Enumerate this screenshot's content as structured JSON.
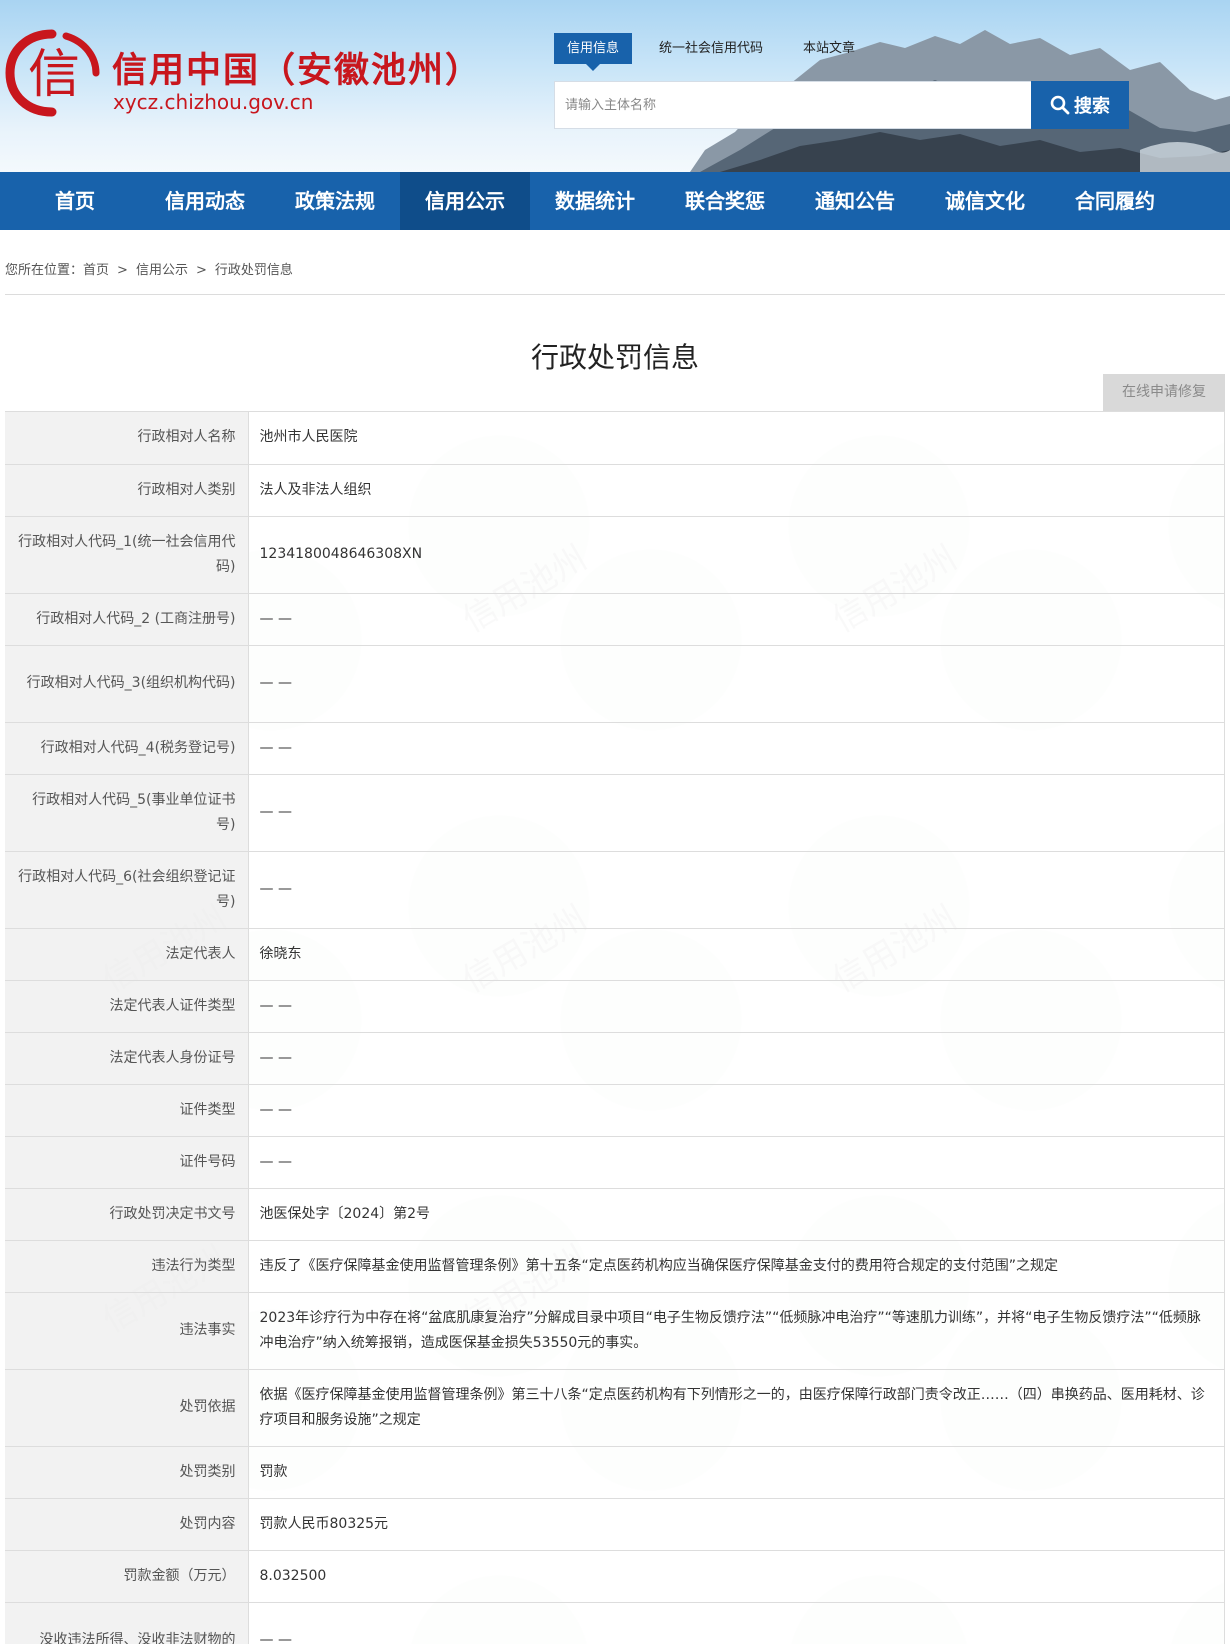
{
  "site": {
    "title": "信用中国（安徽池州）",
    "url": "xycz.chizhou.gov.cn",
    "logo_char": "信"
  },
  "search": {
    "tabs": [
      "信用信息",
      "统一社会信用代码",
      "本站文章"
    ],
    "placeholder": "请输入主体名称",
    "button_label": "搜索"
  },
  "nav": {
    "items": [
      "首页",
      "信用动态",
      "政策法规",
      "信用公示",
      "数据统计",
      "联合奖惩",
      "通知公告",
      "诚信文化",
      "合同履约"
    ],
    "active_index": 3
  },
  "breadcrumb": {
    "prefix": "您所在位置：",
    "items": [
      "首页",
      "信用公示",
      "行政处罚信息"
    ],
    "separator": ">"
  },
  "page_title": "行政处罚信息",
  "repair_button": "在线申请修复",
  "watermark_text": "信用池州",
  "colors": {
    "brand_red": "#c8161d",
    "nav_blue": "#1862ab",
    "nav_active": "#0f4d8a"
  },
  "rows": [
    {
      "label": "行政相对人名称",
      "value": "池州市人民医院"
    },
    {
      "label": "行政相对人类别",
      "value": "法人及非法人组织"
    },
    {
      "label": "行政相对人代码_1(统一社会信用代码)",
      "value": "1234180048646308XN"
    },
    {
      "label": "行政相对人代码_2 (工商注册号)",
      "value": "— —"
    },
    {
      "label": "行政相对人代码_3(组织机构代码)",
      "value": "— —"
    },
    {
      "label": "行政相对人代码_4(税务登记号)",
      "value": "— —"
    },
    {
      "label": "行政相对人代码_5(事业单位证书号)",
      "value": "— —"
    },
    {
      "label": "行政相对人代码_6(社会组织登记证号)",
      "value": "— —"
    },
    {
      "label": "法定代表人",
      "value": "徐晓东"
    },
    {
      "label": "法定代表人证件类型",
      "value": "— —"
    },
    {
      "label": "法定代表人身份证号",
      "value": "— —"
    },
    {
      "label": "证件类型",
      "value": "— —"
    },
    {
      "label": "证件号码",
      "value": "— —"
    },
    {
      "label": "行政处罚决定书文号",
      "value": "池医保处字〔2024〕第2号"
    },
    {
      "label": "违法行为类型",
      "value": "违反了《医疗保障基金使用监督管理条例》第十五条“定点医药机构应当确保医疗保障基金支付的费用符合规定的支付范围”之规定"
    },
    {
      "label": "违法事实",
      "value": "2023年诊疗行为中存在将“盆底肌康复治疗”分解成目录中项目“电子生物反馈疗法”“低频脉冲电治疗”“等速肌力训练”，并将“电子生物反馈疗法”“低频脉冲电治疗”纳入统筹报销，造成医保基金损失53550元的事实。"
    },
    {
      "label": "处罚依据",
      "value": "依据《医疗保障基金使用监督管理条例》第三十八条“定点医药机构有下列情形之一的，由医疗保障行政部门责令改正……（四）串换药品、医用耗材、诊疗项目和服务设施”之规定"
    },
    {
      "label": "处罚类别",
      "value": "罚款"
    },
    {
      "label": "处罚内容",
      "value": "罚款人民币80325元"
    },
    {
      "label": "罚款金额（万元）",
      "value": "8.032500"
    },
    {
      "label": "没收违法所得、没收非法财物的",
      "value": "— —"
    }
  ]
}
